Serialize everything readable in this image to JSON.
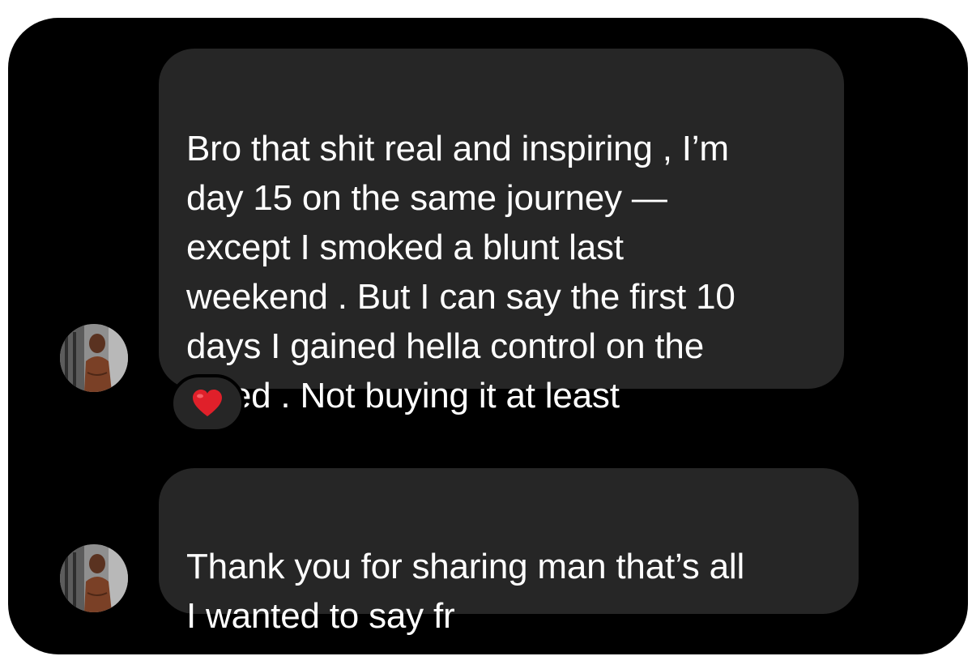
{
  "conversation": {
    "messages": [
      {
        "text": "Bro that shit real and inspiring , I’m\nday 15 on the same journey —\nexcept I smoked a blunt last\nweekend . But I can say the first 10\ndays I gained hella control on the\nweed . Not buying it at least",
        "reaction": "heart-icon"
      },
      {
        "text": "Thank you for sharing man that’s all\nI wanted to say fr"
      }
    ]
  },
  "colors": {
    "background": "#000000",
    "bubble": "#262626",
    "text": "#ffffff",
    "reaction_heart": "#e0202a"
  }
}
